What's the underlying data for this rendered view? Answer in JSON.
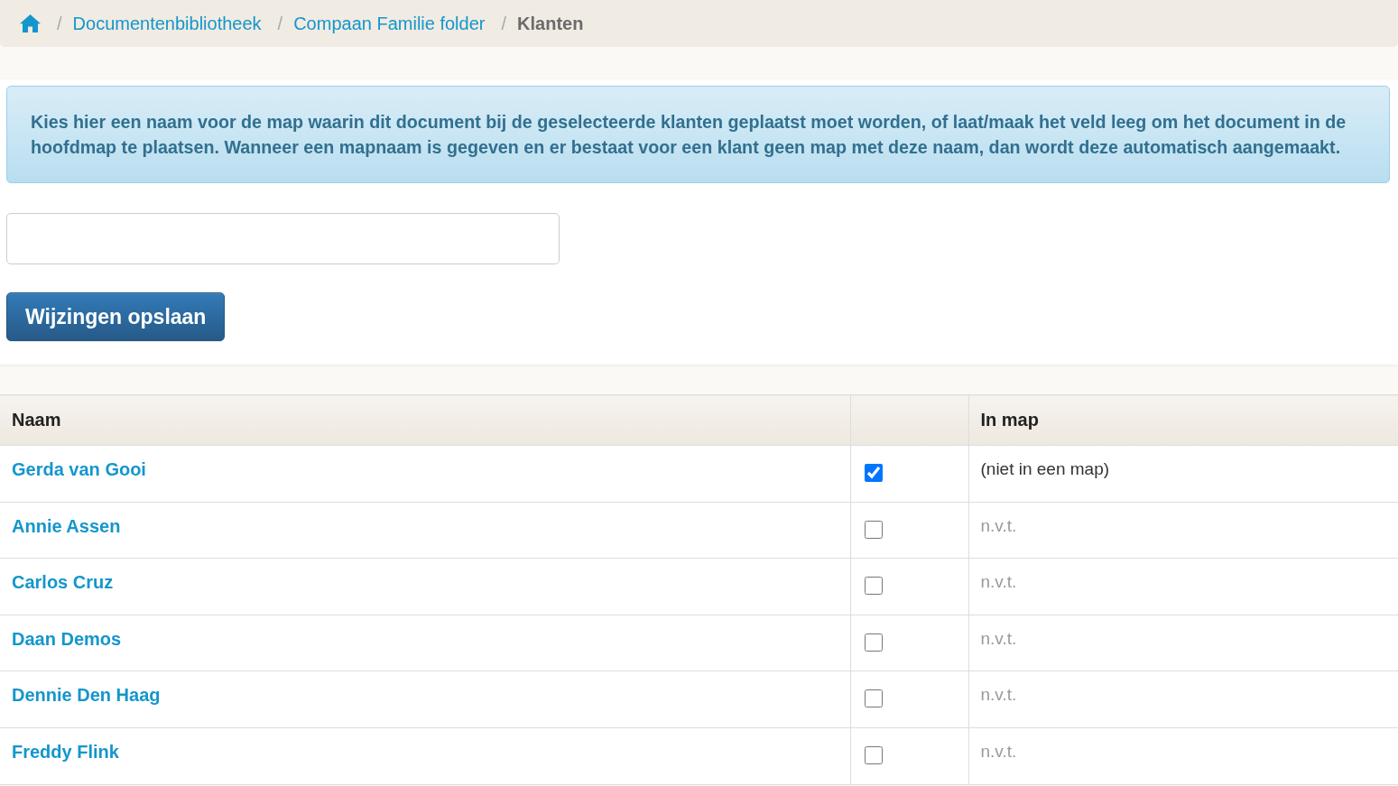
{
  "breadcrumb": [
    {
      "separator": "/",
      "label": "Documentenbibliotheek",
      "kind": "link"
    },
    {
      "separator": "/",
      "label": "Compaan Familie folder",
      "kind": "link"
    },
    {
      "separator": "/",
      "label": "Klanten",
      "kind": "current"
    }
  ],
  "notice": "Kies hier een naam voor de map waarin dit document bij de geselecteerde klanten geplaatst moet worden, of laat/maak het veld leeg om het document in de hoofdmap te plaatsen. Wanneer een mapnaam is gegeven en er bestaat voor een klant geen map met deze naam, dan wordt deze automatisch aangemaakt.",
  "save_button": "Wijzingen opslaan",
  "table": {
    "columns": [
      {
        "kind": "name",
        "label": "Naam"
      },
      {
        "kind": "select"
      },
      {
        "kind": "folder",
        "label": "In map"
      }
    ],
    "rows": [
      {
        "name": "Gerda van Gooi",
        "checked": true,
        "in_map": "(niet in een map)"
      },
      {
        "name": "Annie Assen",
        "checked": false,
        "in_map": "n.v.t."
      },
      {
        "name": "Carlos Cruz",
        "checked": false,
        "in_map": "n.v.t."
      },
      {
        "name": "Daan Demos",
        "checked": false,
        "in_map": "n.v.t."
      },
      {
        "name": "Dennie Den Haag",
        "checked": false,
        "in_map": "n.v.t."
      },
      {
        "name": "Freddy Flink",
        "checked": false,
        "in_map": "n.v.t."
      }
    ]
  }
}
